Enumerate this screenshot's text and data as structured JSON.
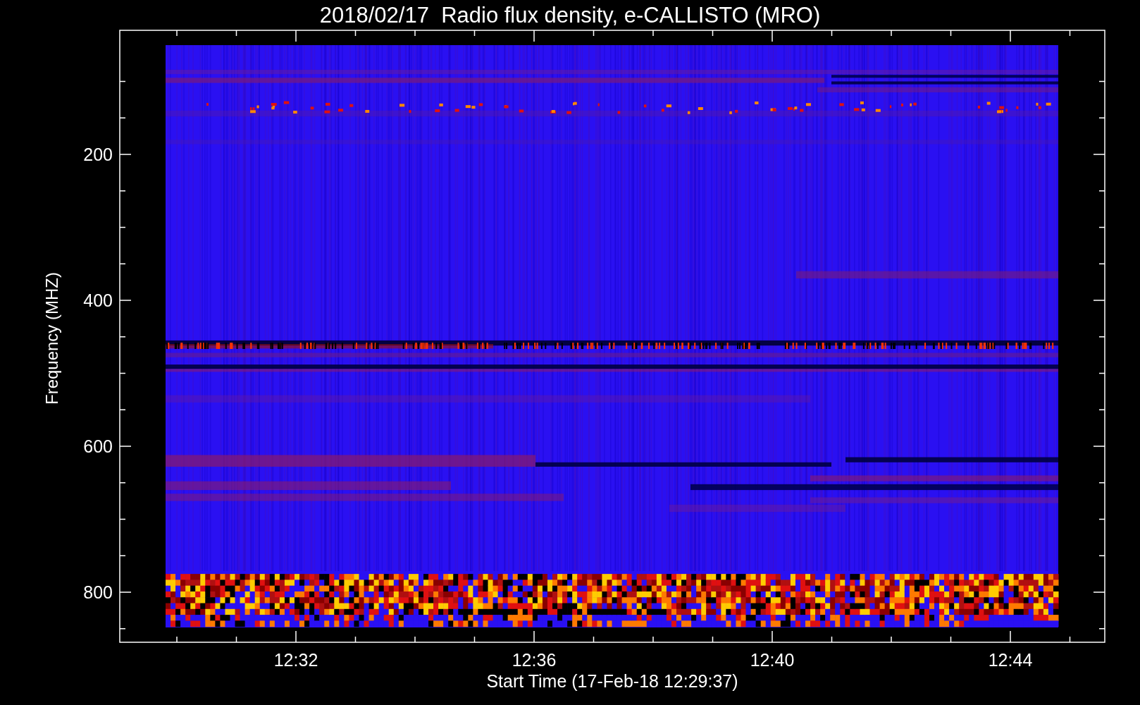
{
  "title": "2018/02/17  Radio flux density, e-CALLISTO (MRO)",
  "y_axis": {
    "label": "Frequency (MHZ)",
    "ticks": [
      "200",
      "400",
      "600",
      "800"
    ]
  },
  "x_axis": {
    "label": "Start Time (17-Feb-18 12:29:37)",
    "ticks": [
      "12:32",
      "12:36",
      "12:40",
      "12:44"
    ]
  }
}
